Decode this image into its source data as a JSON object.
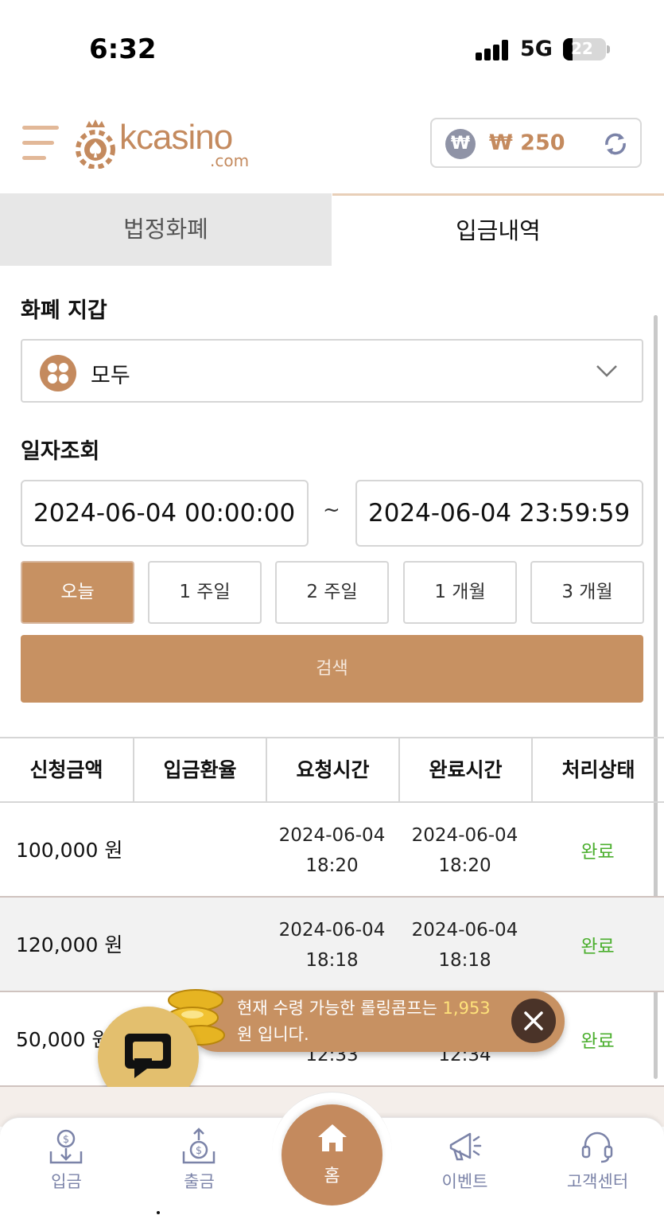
{
  "status_bar": {
    "time": "6:32",
    "network": "5G",
    "battery": "22"
  },
  "header": {
    "logo_main": "kcasino",
    "logo_sub": ".com",
    "currency_symbol": "₩",
    "balance": "₩ 250"
  },
  "tabs": [
    {
      "label": "법정화폐",
      "active": false
    },
    {
      "label": "입금내역",
      "active": true
    }
  ],
  "filters": {
    "wallet_label": "화폐 지갑",
    "wallet_selected": "모두",
    "date_label": "일자조회",
    "date_from": "2024-06-04 00:00:00",
    "date_to": "2024-06-04 23:59:59",
    "date_sep": "~",
    "periods": [
      "오늘",
      "1 주일",
      "2 주일",
      "1 개월",
      "3 개월"
    ],
    "active_period": "오늘",
    "search_label": "검색"
  },
  "table": {
    "columns": [
      "신청금액",
      "입금환율",
      "요청시간",
      "완료시간",
      "처리상태"
    ],
    "rows": [
      {
        "amount": "100,000 원",
        "rate": "",
        "req_date": "2024-06-04",
        "req_time": "18:20",
        "done_date": "2024-06-04",
        "done_time": "18:20",
        "status": "완료"
      },
      {
        "amount": "120,000 원",
        "rate": "",
        "req_date": "2024-06-04",
        "req_time": "18:18",
        "done_date": "2024-06-04",
        "done_time": "18:18",
        "status": "완료"
      },
      {
        "amount": "50,000 원",
        "rate": "",
        "req_date": "",
        "req_time": "12:33",
        "done_date": "",
        "done_time": "12:34",
        "status": "완료"
      }
    ]
  },
  "toast": {
    "text_before": "현재 수령 가능한 롤링콤프는 ",
    "highlight": "1,953",
    "text_after": "원 입니다."
  },
  "bottom_nav": [
    {
      "label": "입금",
      "icon": "deposit-icon"
    },
    {
      "label": "출금",
      "icon": "withdraw-icon"
    },
    {
      "label": "홈",
      "icon": "home-icon"
    },
    {
      "label": "이벤트",
      "icon": "megaphone-icon"
    },
    {
      "label": "고객센터",
      "icon": "headset-icon"
    }
  ],
  "colors": {
    "accent": "#c79162",
    "brand": "#c48a5e",
    "status_done": "#4caf2f",
    "nav_text": "#7b83a8"
  }
}
